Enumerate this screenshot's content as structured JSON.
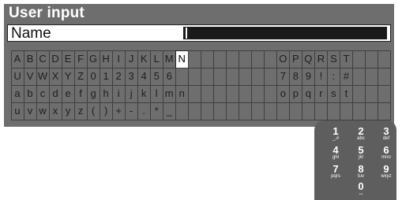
{
  "title": "User input",
  "name_field": {
    "label": "Name",
    "value": ""
  },
  "grid_rows": [
    [
      "A",
      "B",
      "C",
      "D",
      "E",
      "F",
      "G",
      "H",
      "I",
      "J",
      "K",
      "L",
      "M",
      "N",
      "",
      "",
      "",
      "",
      "",
      "",
      "",
      "O",
      "P",
      "Q",
      "R",
      "S",
      "T",
      "",
      "",
      ""
    ],
    [
      "U",
      "V",
      "W",
      "X",
      "Y",
      "Z",
      "0",
      "1",
      "2",
      "3",
      "4",
      "5",
      "6",
      "",
      "",
      "",
      "",
      "",
      "",
      "",
      "",
      "7",
      "8",
      "9",
      "!",
      ":",
      "#",
      "",
      "",
      ""
    ],
    [
      "a",
      "b",
      "c",
      "d",
      "e",
      "f",
      "g",
      "h",
      "i",
      "j",
      "k",
      "l",
      "m",
      "n",
      "",
      "",
      "",
      "",
      "",
      "",
      "",
      "o",
      "p",
      "q",
      "r",
      "s",
      "t",
      "",
      "",
      ""
    ],
    [
      "u",
      "v",
      "w",
      "x",
      "y",
      "z",
      "(",
      ")",
      "+",
      "-",
      ".",
      "*",
      "_",
      "",
      "",
      "",
      "",
      "",
      "",
      "",
      "",
      "",
      "",
      "",
      "",
      "",
      "",
      "",
      "",
      ""
    ]
  ],
  "selected_cell": {
    "row": 0,
    "col": 13
  },
  "keypad": [
    {
      "digit": "1",
      "sub": "_,#"
    },
    {
      "digit": "2",
      "sub": "abc"
    },
    {
      "digit": "3",
      "sub": "def"
    },
    {
      "digit": "4",
      "sub": "ghi"
    },
    {
      "digit": "5",
      "sub": "jkl"
    },
    {
      "digit": "6",
      "sub": "mno"
    },
    {
      "digit": "7",
      "sub": "pqrs"
    },
    {
      "digit": "8",
      "sub": "tuv"
    },
    {
      "digit": "9",
      "sub": "wxyz"
    },
    {
      "digit": "0",
      "sub": "⌴"
    }
  ],
  "colors": {
    "panel": "#6e6e6e",
    "cell_border": "#3f3f3f",
    "selected": "#ffffff",
    "keypad": "#5e5e5e"
  }
}
